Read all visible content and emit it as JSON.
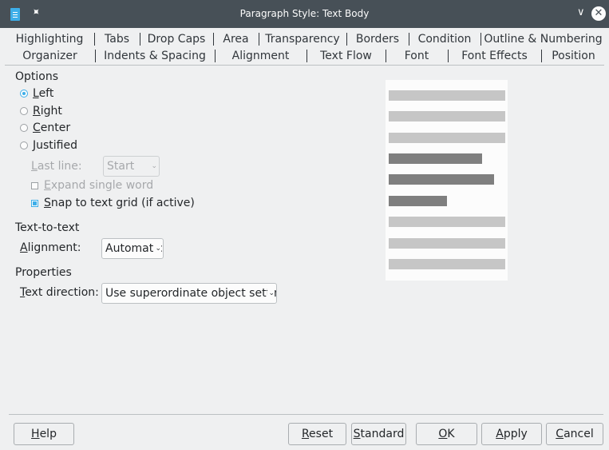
{
  "window": {
    "title": "Paragraph Style: Text Body"
  },
  "tabs_row1": [
    "Highlighting",
    "Tabs",
    "Drop Caps",
    "Area",
    "Transparency",
    "Borders",
    "Condition",
    "Outline & Numbering"
  ],
  "tabs_row2": [
    "Organizer",
    "Indents & Spacing",
    "Alignment",
    "Text Flow",
    "Font",
    "Font Effects",
    "Position"
  ],
  "active_tab": "Alignment",
  "options": {
    "heading": "Options",
    "left": {
      "mn": "L",
      "rest": "eft",
      "selected": true
    },
    "right": {
      "mn": "R",
      "rest": "ight",
      "selected": false
    },
    "center": {
      "mn": "C",
      "rest": "enter",
      "selected": false
    },
    "justified": {
      "mn": "J",
      "rest": "ustified",
      "selected": false
    },
    "last_line_label_mn": "L",
    "last_line_label_rest": "ast line:",
    "last_line_value": "Start",
    "expand_mn": "E",
    "expand_rest": "xpand single word",
    "expand_checked": false,
    "snap_mn": "S",
    "snap_rest": "nap to text grid (if active)",
    "snap_checked": true
  },
  "text_to_text": {
    "heading": "Text-to-text",
    "alignment_label_mn": "A",
    "alignment_label_rest": "lignment:",
    "alignment_value": "Automatic"
  },
  "properties": {
    "heading": "Properties",
    "direction_label_mn": "T",
    "direction_label_rest": "ext direction:",
    "direction_value": "Use superordinate object settings"
  },
  "buttons": {
    "help_mn": "H",
    "help_rest": "elp",
    "reset_mn": "R",
    "reset_rest": "eset",
    "standard_mn": "S",
    "standard_rest": "tandard",
    "ok_mn": "O",
    "ok_rest": "K",
    "apply_mn": "A",
    "apply_rest": "pply",
    "cancel_mn": "C",
    "cancel_rest": "ancel"
  },
  "colors": {
    "titlebar": "#475057",
    "accent": "#3daee9",
    "window_bg": "#eff0f1"
  }
}
